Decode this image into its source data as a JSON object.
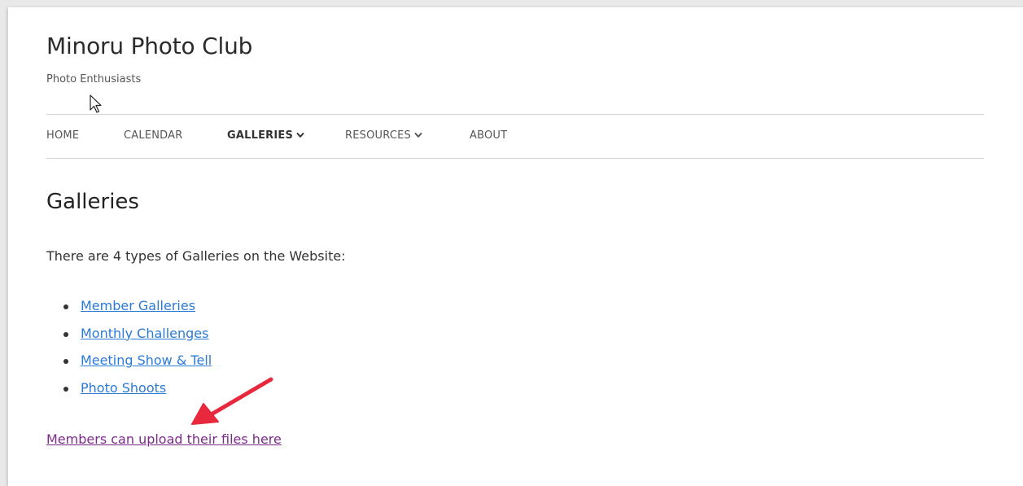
{
  "site": {
    "title": "Minoru Photo Club",
    "tagline": "Photo Enthusiasts"
  },
  "nav": {
    "items": [
      {
        "label": "HOME",
        "active": false,
        "has_dropdown": false
      },
      {
        "label": "CALENDAR",
        "active": false,
        "has_dropdown": false
      },
      {
        "label": "GALLERIES",
        "active": true,
        "has_dropdown": true
      },
      {
        "label": "RESOURCES",
        "active": false,
        "has_dropdown": true
      },
      {
        "label": "ABOUT",
        "active": false,
        "has_dropdown": false
      }
    ]
  },
  "main": {
    "heading": "Galleries",
    "intro": "There are 4 types of Galleries on the Website:",
    "gallery_links": [
      "Member Galleries",
      "Monthly Challenges",
      "Meeting Show & Tell",
      "Photo Shoots"
    ],
    "upload_link": "Members can upload their files here"
  },
  "icons": {
    "cursor": "mouse-pointer-icon",
    "dropdown": "chevron-down-icon",
    "annotation": "red-arrow-icon"
  },
  "colors": {
    "link": "#2a7ad6",
    "visited_link": "#7b2a8a",
    "annotation_arrow": "#e8283c"
  }
}
